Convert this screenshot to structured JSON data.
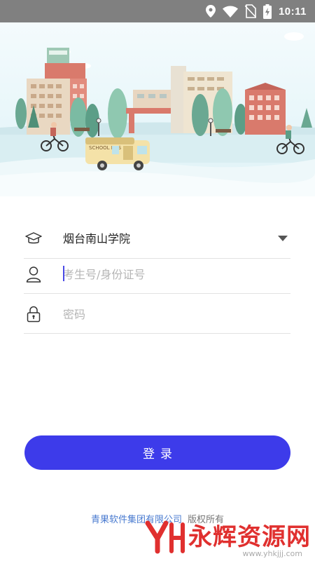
{
  "status_bar": {
    "time": "10:11",
    "icons": [
      "location-icon",
      "wifi-icon",
      "no-sim-icon",
      "battery-charging-icon"
    ]
  },
  "banner": {
    "bus_label": "SCHOOL BUS",
    "scene": "campus-illustration"
  },
  "form": {
    "school": {
      "value": "烟台南山学院",
      "icon": "graduation-cap-icon",
      "dropdown_icon": "dropdown-arrow-icon"
    },
    "username": {
      "placeholder": "考生号/身份证号",
      "value": "",
      "icon": "user-icon"
    },
    "password": {
      "placeholder": "密码",
      "value": "",
      "icon": "lock-icon"
    }
  },
  "login_button": {
    "label": "登录"
  },
  "footer": {
    "company": "青果软件集团有限公司",
    "rights": "版权所有"
  },
  "watermark": {
    "text": "永辉资源网",
    "url": "www.yhkjjj.com"
  },
  "colors": {
    "status_bar": "#808080",
    "primary": "#3d3bea",
    "footer_link": "#4a7bd0",
    "watermark": "#e0302f"
  }
}
